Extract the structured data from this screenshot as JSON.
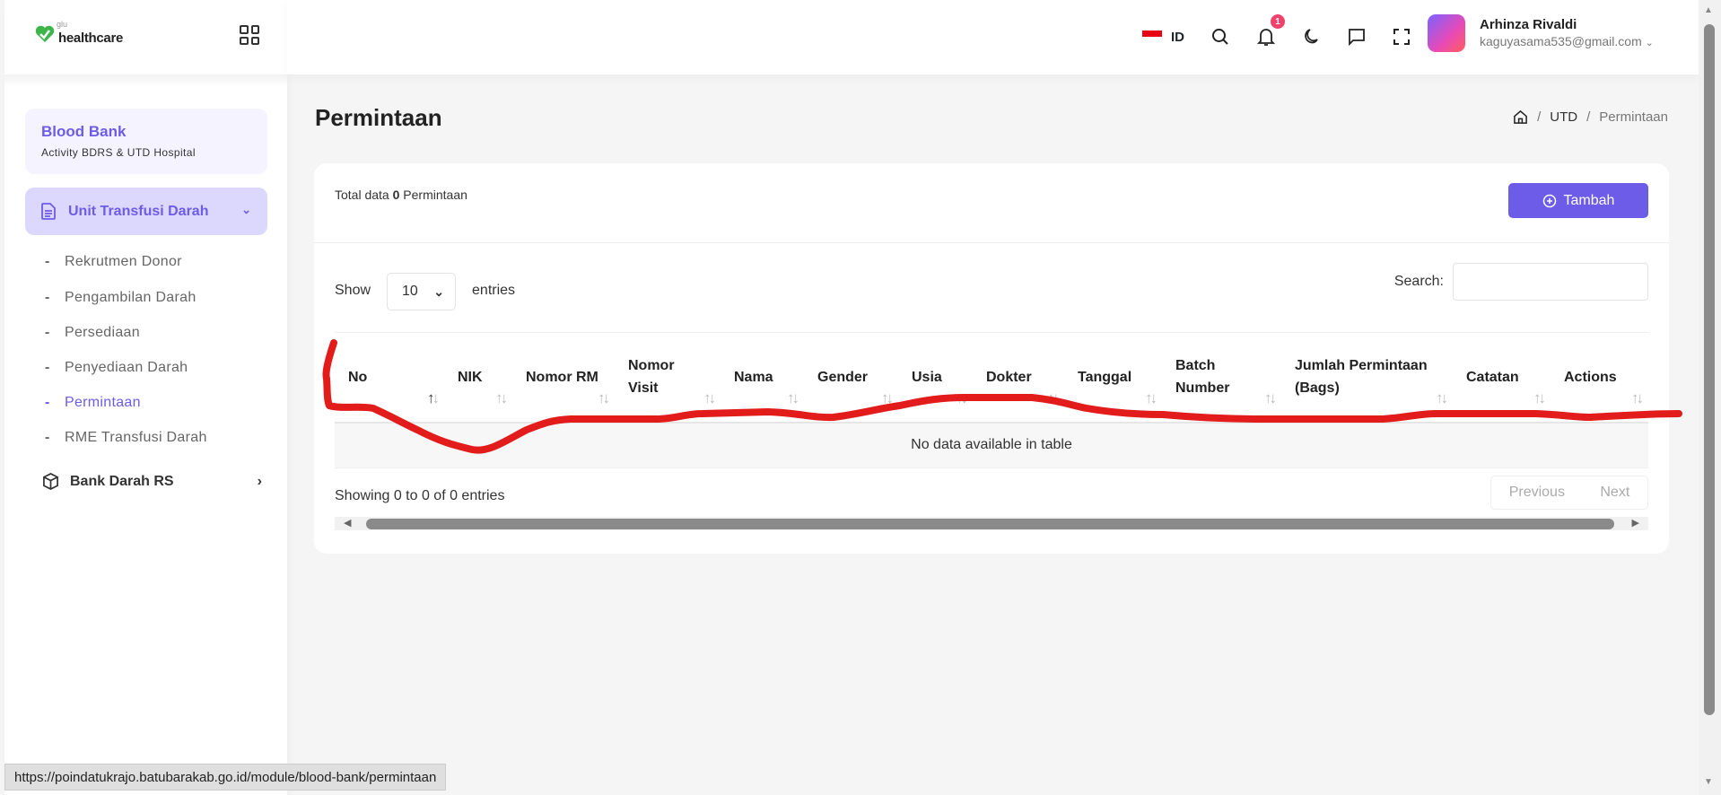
{
  "logo": {
    "small": "glu",
    "big": "healthcare"
  },
  "sidebar": {
    "card_title": "Blood Bank",
    "card_subtitle": "Activity BDRS & UTD Hospital",
    "active_group": "Unit Transfusi Darah",
    "items": [
      {
        "label": "Rekrutmen Donor"
      },
      {
        "label": "Pengambilan Darah"
      },
      {
        "label": "Persediaan"
      },
      {
        "label": "Penyediaan Darah"
      },
      {
        "label": "Permintaan",
        "active": true
      },
      {
        "label": "RME Transfusi Darah"
      }
    ],
    "group2": "Bank Darah RS"
  },
  "topbar": {
    "lang": "ID",
    "notif_count": "1",
    "user_name": "Arhinza Rivaldi",
    "user_email": "kaguyasama535@gmail.com"
  },
  "page": {
    "title": "Permintaan",
    "breadcrumb": [
      "UTD",
      "Permintaan"
    ]
  },
  "card": {
    "total_prefix": "Total data",
    "total_count": "0",
    "total_suffix": "Permintaan",
    "add_label": "Tambah",
    "show_label": "Show",
    "entries_value": "10",
    "entries_label": "entries",
    "search_label": "Search:",
    "search_value": "",
    "columns": [
      "No",
      "NIK",
      "Nomor RM",
      "Nomor Visit",
      "Nama",
      "Gender",
      "Usia",
      "Dokter",
      "Tanggal",
      "Batch Number",
      "Jumlah Permintaan (Bags)",
      "Catatan",
      "Actions"
    ],
    "empty_text": "No data available in table",
    "showing_text": "Showing 0 to 0 of 0 entries",
    "prev_label": "Previous",
    "next_label": "Next"
  },
  "status_url": "https://poindatukrajo.batubarakab.go.id/module/blood-bank/permintaan",
  "colors": {
    "accent": "#6c5ce7",
    "annotation": "#e21b1b",
    "badge": "#f1416c"
  }
}
